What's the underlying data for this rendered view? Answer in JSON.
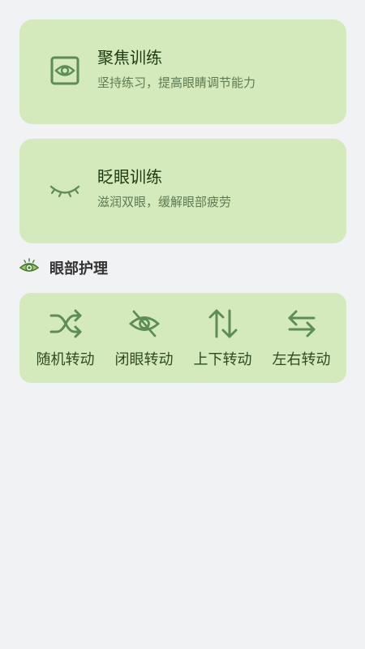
{
  "colors": {
    "card_background": "#d5eabc",
    "page_background": "#f1f2f4",
    "icon": "#5e8c56",
    "title": "#1e3a12",
    "subtitle": "#5e7a54"
  },
  "cards": [
    {
      "title": "聚焦训练",
      "subtitle": "坚持练习，提高眼睛调节能力",
      "icon": "focus-eye-icon"
    },
    {
      "title": "眨眼训练",
      "subtitle": "滋润双眼，缓解眼部疲劳",
      "icon": "closed-eye-icon"
    }
  ],
  "section": {
    "title": "眼部护理",
    "icon": "eye-care-icon"
  },
  "exercises": [
    {
      "label": "随机转动",
      "icon": "shuffle-icon"
    },
    {
      "label": "闭眼转动",
      "icon": "eye-off-icon"
    },
    {
      "label": "上下转动",
      "icon": "up-down-arrows-icon"
    },
    {
      "label": "左右转动",
      "icon": "left-right-arrows-icon"
    }
  ]
}
